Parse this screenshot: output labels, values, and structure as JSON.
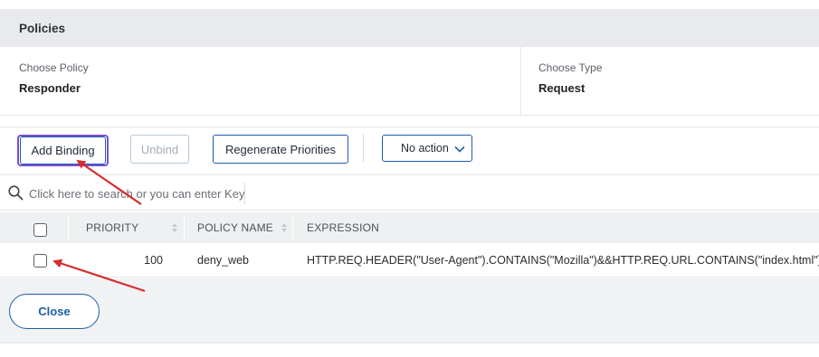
{
  "policies": {
    "title": "Policies",
    "choose_policy_label": "Choose Policy",
    "choose_policy_value": "Responder",
    "choose_type_label": "Choose Type",
    "choose_type_value": "Request"
  },
  "toolbar": {
    "add_binding": "Add Binding",
    "unbind": "Unbind",
    "regenerate_priorities": "Regenerate Priorities",
    "action_selected": "No action"
  },
  "search": {
    "placeholder": "Click here to search or you can enter Key : Value format"
  },
  "table": {
    "columns": [
      "PRIORITY",
      "POLICY NAME",
      "EXPRESSION"
    ],
    "rows": [
      {
        "priority": "100",
        "policy_name": "deny_web",
        "expression": "HTTP.REQ.HEADER(\"User-Agent\").CONTAINS(\"Mozilla\")&&HTTP.REQ.URL.CONTAINS(\"index.html\")"
      }
    ]
  },
  "footer": {
    "close": "Close"
  },
  "colors": {
    "accent": "#1a5fa8",
    "focus_ring": "#7a4fd4",
    "annotation_arrow": "#d62d2d"
  }
}
